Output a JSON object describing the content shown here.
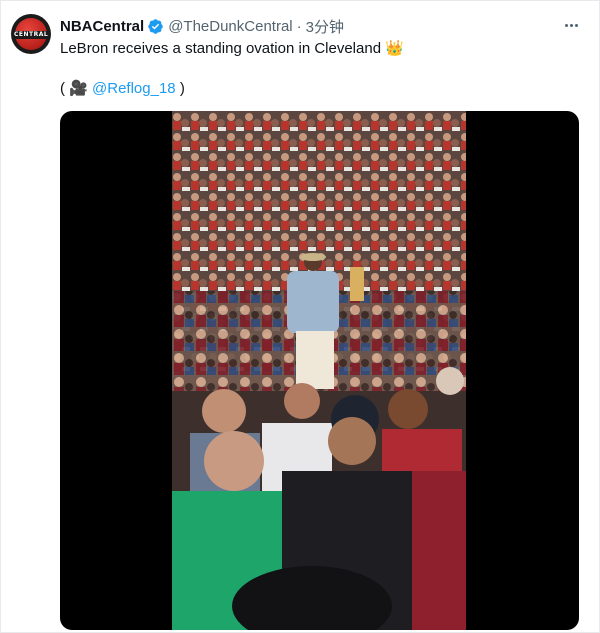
{
  "tweet": {
    "author_name": "NBACentral",
    "handle": "@TheDunkCentral",
    "separator": "·",
    "time": "3分钟",
    "text": "LeBron receives a standing ovation in Cleveland",
    "text_emoji": "👑",
    "credit_open": "(",
    "credit_icon": "🎥",
    "credit_link": "@Reflog_18",
    "credit_close": ")"
  },
  "avatar_logo_text": "CENTRAL",
  "colors": {
    "link": "#1d9bf0",
    "verified": "#1d9bf0",
    "secondary_text": "#536471",
    "primary_text": "#0f1419"
  },
  "icons": [
    "verified-badge-icon",
    "more-options-icon",
    "crown-emoji-icon",
    "video-camera-icon"
  ]
}
